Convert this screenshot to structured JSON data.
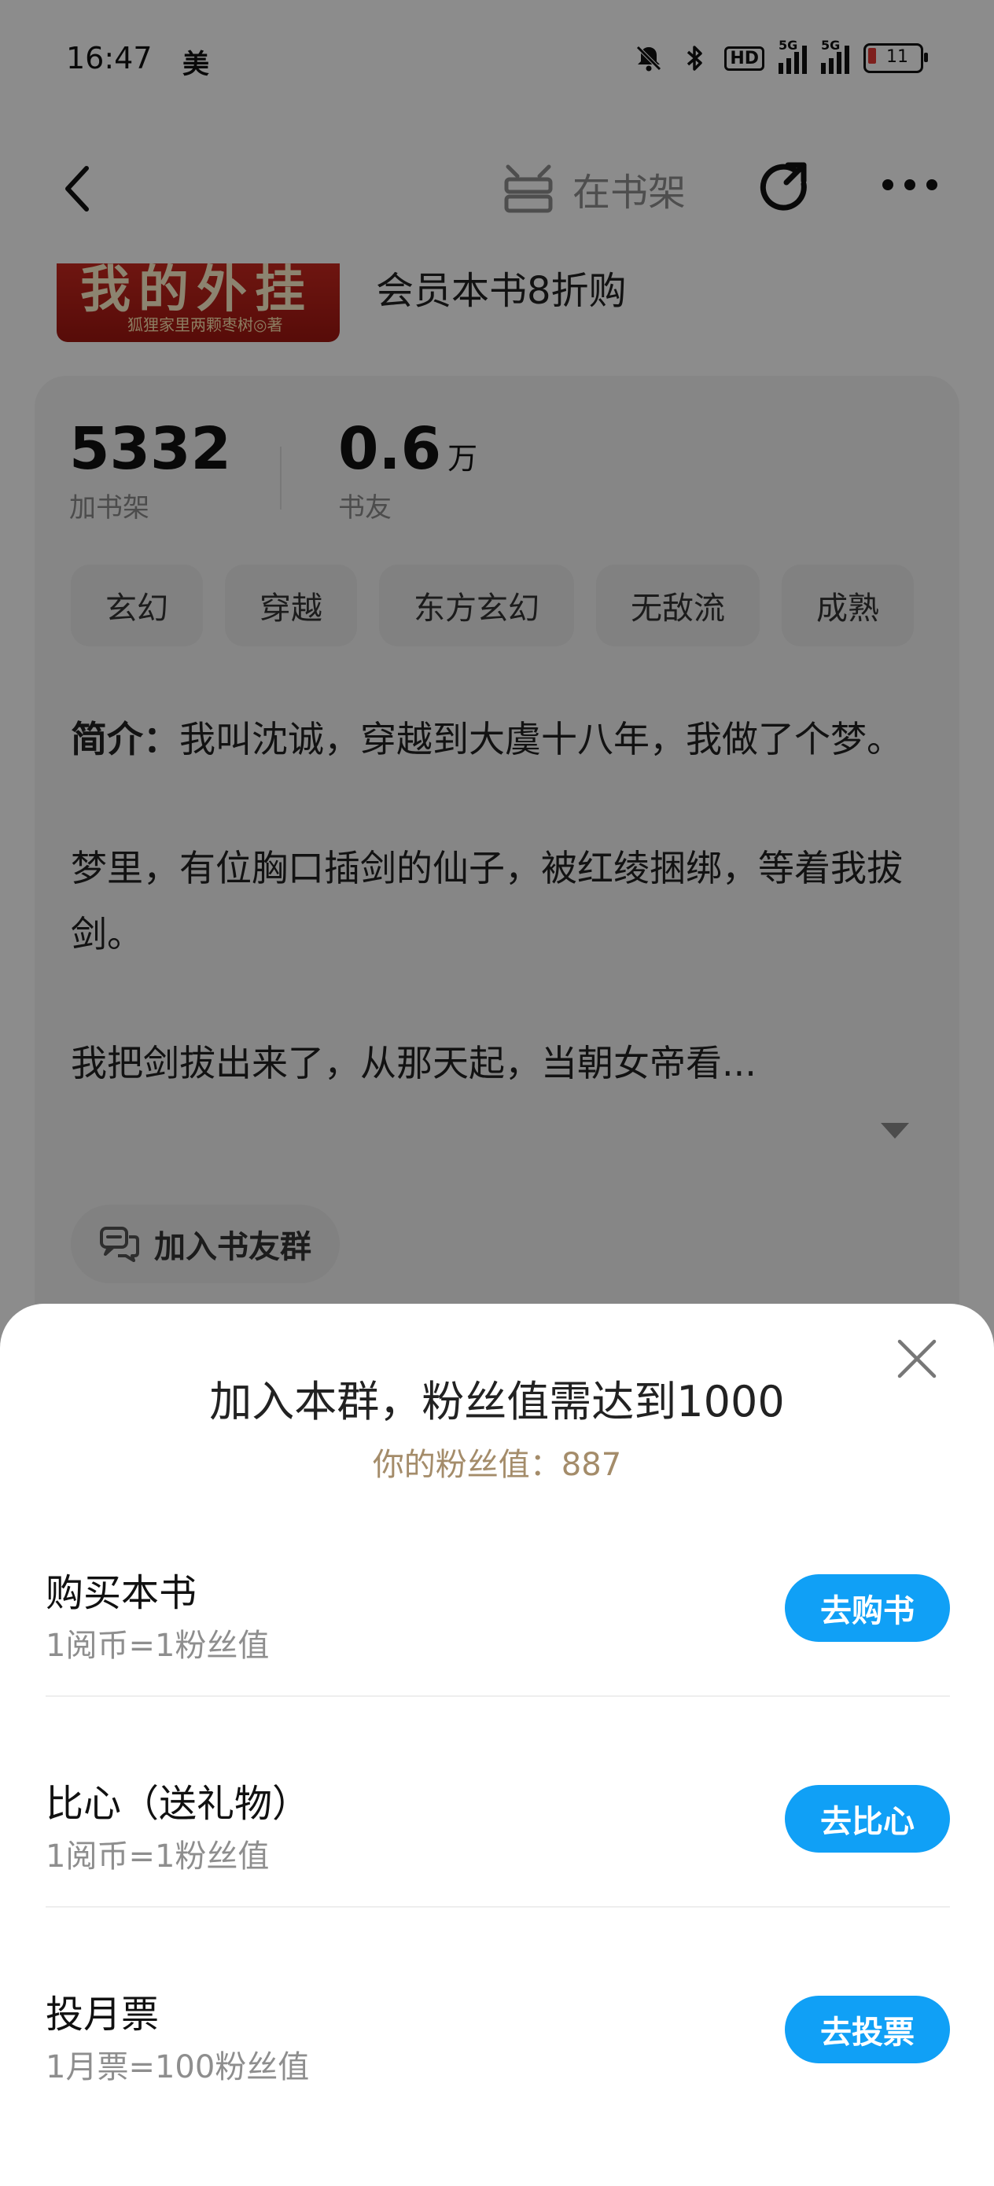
{
  "status_bar": {
    "time": "16:47",
    "carrier": "美",
    "hd_label": "HD",
    "signal_label": "5G",
    "battery_level": "11"
  },
  "nav": {
    "shelf_label": "在书架"
  },
  "book": {
    "cover_title": "我的外挂",
    "cover_author": "狐狸家里两颗枣树◎著",
    "vip_offer": "会员本书8折购"
  },
  "stats": [
    {
      "value": "5332",
      "unit": "",
      "label": "加书架"
    },
    {
      "value": "0.6",
      "unit": "万",
      "label": "书友"
    }
  ],
  "tags": [
    "玄幻",
    "穿越",
    "东方玄幻",
    "无敌流",
    "成熟"
  ],
  "intro": {
    "label": "简介：",
    "paragraphs": [
      "我叫沈诚，穿越到大虞十八年，我做了个梦。",
      "梦里，有位胸口插剑的仙子，被红绫捆绑，等着我拔剑。",
      "我把剑拔出来了，从那天起，当朝女帝看..."
    ]
  },
  "group_button": "加入书友群",
  "sheet": {
    "title": "加入本群，粉丝值需达到1000",
    "subtitle": "你的粉丝值：887",
    "items": [
      {
        "name": "购买本书",
        "desc": "1阅币=1粉丝值",
        "button": "去购书"
      },
      {
        "name": "比心（送礼物）",
        "desc": "1阅币=1粉丝值",
        "button": "去比心"
      },
      {
        "name": "投月票",
        "desc": "1月票=100粉丝值",
        "button": "去投票"
      }
    ]
  },
  "colors": {
    "accent": "#10a0f6",
    "subtitle": "#a48c6a",
    "overlay": "rgba(0,0,0,0.45)"
  }
}
